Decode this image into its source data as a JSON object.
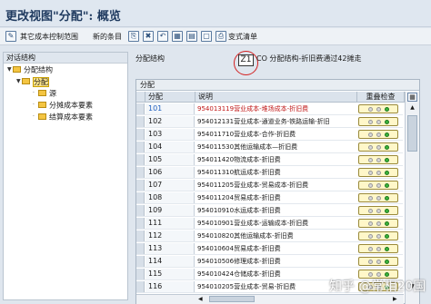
{
  "window": {
    "title": "更改视图\"分配\": 概览"
  },
  "toolbar": {
    "other_range": "其它成本控制范围",
    "new_entries": "新的条目",
    "change_list": "变式清单"
  },
  "left": {
    "header": "对话结构",
    "tree": [
      "分配结构",
      "分配",
      "源",
      "分摊成本要素",
      "结算成本要素"
    ]
  },
  "right": {
    "field_label": "分配结构",
    "field_value": "Z1",
    "field_desc": "CO 分配结构-折旧费通过42摊走"
  },
  "table": {
    "title": "分配",
    "columns": [
      "分配",
      "说明",
      "重叠检查"
    ],
    "rows": [
      {
        "code": "101",
        "desc": "954013119营业成本-堆场成本-折旧费",
        "red": true
      },
      {
        "code": "102",
        "desc": "954012131营业成本-通道业务-铁路运输-折旧",
        "red": false
      },
      {
        "code": "103",
        "desc": "954011710营业成本-合作-折旧费",
        "red": false
      },
      {
        "code": "104",
        "desc": "954011530其他运输成本—折旧费",
        "red": false
      },
      {
        "code": "105",
        "desc": "954011420物流成本-折旧费",
        "red": false
      },
      {
        "code": "106",
        "desc": "954011310航运成本-折旧费",
        "red": false
      },
      {
        "code": "107",
        "desc": "954011205营业成本-贸易成本-折旧费",
        "red": false
      },
      {
        "code": "108",
        "desc": "954011204贸易成本-折旧费",
        "red": false
      },
      {
        "code": "109",
        "desc": "954010910水运成本-折旧费",
        "red": false
      },
      {
        "code": "111",
        "desc": "954010901营业成本-运输成本-折旧费",
        "red": false
      },
      {
        "code": "112",
        "desc": "954010820其他运输成本-折旧费",
        "red": false
      },
      {
        "code": "113",
        "desc": "954010604贸易成本-折旧费",
        "red": false
      },
      {
        "code": "114",
        "desc": "954010506修理成本-折旧费",
        "red": false
      },
      {
        "code": "115",
        "desc": "954010424仓储成本-折旧费",
        "red": false
      },
      {
        "code": "116",
        "desc": "954010205营业成本-贸易-折旧费",
        "red": false
      }
    ]
  },
  "watermark": "知乎 @常相20国",
  "colors": {
    "accent": "#1f3a5f",
    "selection": "#ffe58a",
    "red_text": "#c01818",
    "check_bg": "#fff7c9"
  }
}
